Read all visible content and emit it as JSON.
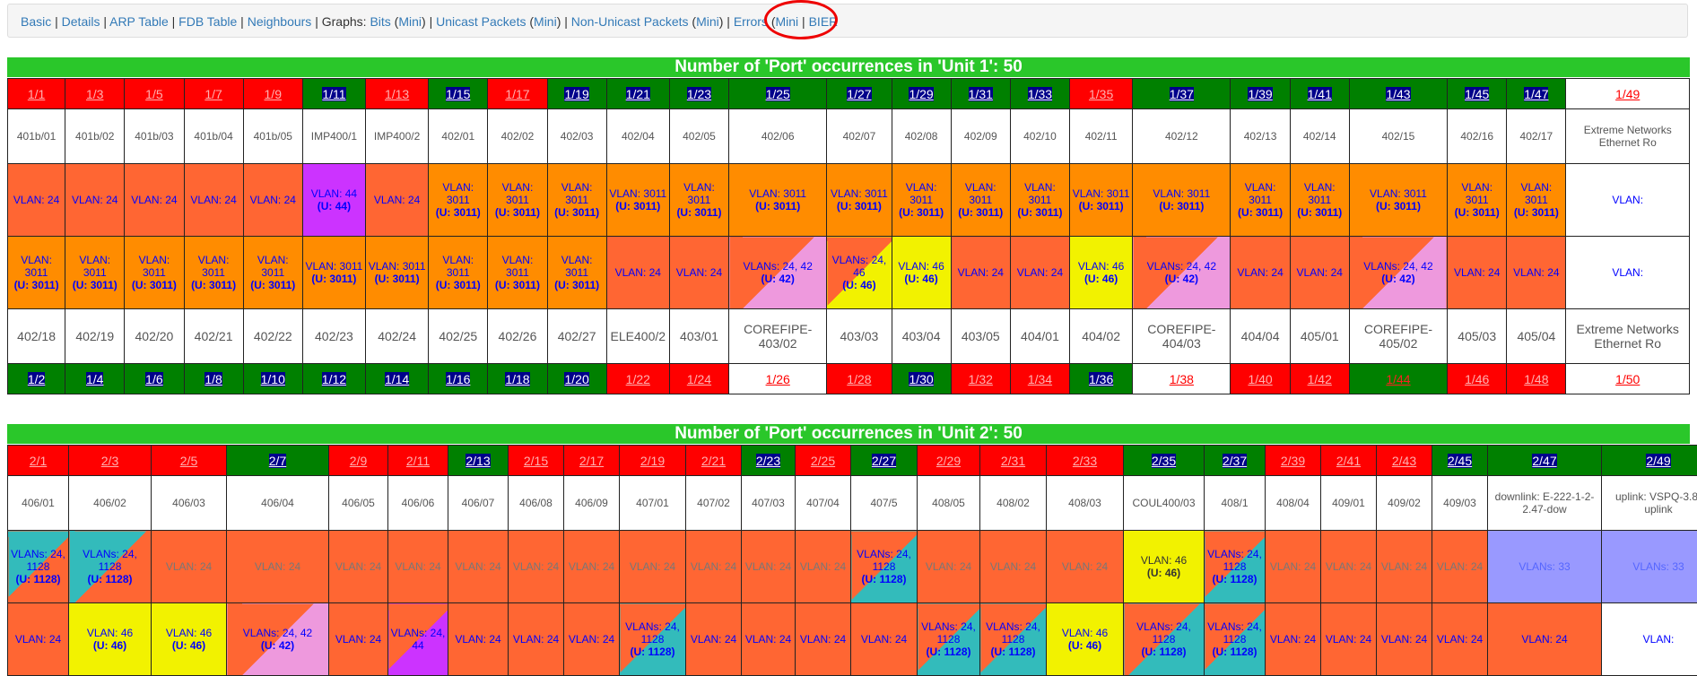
{
  "nav": {
    "basic": "Basic",
    "details": "Details",
    "arp": "ARP Table",
    "fdb": "FDB Table",
    "neighbours": "Neighbours",
    "graphs": "Graphs:",
    "bits": "Bits",
    "unicast": "Unicast Packets",
    "nonunicast": "Non-Unicast Packets",
    "errors": "Errors",
    "mini": "Mini",
    "bier": "BIER"
  },
  "unit1": {
    "title": "Number of 'Port' occurrences in 'Unit 1': 50",
    "top_ports": [
      "1/1",
      "1/3",
      "1/5",
      "1/7",
      "1/9",
      "1/11",
      "1/13",
      "1/15",
      "1/17",
      "1/19",
      "1/21",
      "1/23",
      "1/25",
      "1/27",
      "1/29",
      "1/31",
      "1/33",
      "1/35",
      "1/37",
      "1/39",
      "1/41",
      "1/43",
      "1/45",
      "1/47",
      "1/49"
    ],
    "top_desc": [
      "401b/01",
      "401b/02",
      "401b/03",
      "401b/04",
      "401b/05",
      "IMP400/1",
      "IMP400/2",
      "402/01",
      "402/02",
      "402/03",
      "402/04",
      "402/05",
      "402/06",
      "402/07",
      "402/08",
      "402/09",
      "402/10",
      "402/11",
      "402/12",
      "402/13",
      "402/14",
      "402/15",
      "402/16",
      "402/17",
      "Extreme Networks Ethernet Ro"
    ],
    "top_vlan_a": [
      "VLAN: 24",
      "VLAN: 24",
      "VLAN: 24",
      "VLAN: 24",
      "VLAN: 24",
      "VLAN: 44",
      "VLAN: 24",
      "VLAN: 3011",
      "VLAN: 3011",
      "VLAN: 3011",
      "VLAN: 3011",
      "VLAN: 3011",
      "VLAN: 3011",
      "VLAN: 3011",
      "VLAN: 3011",
      "VLAN: 3011",
      "VLAN: 3011",
      "VLAN: 3011",
      "VLAN: 3011",
      "VLAN: 3011",
      "VLAN: 3011",
      "VLAN: 3011",
      "VLAN: 3011",
      "VLAN: 3011",
      "VLAN:"
    ],
    "top_vlan_b": [
      "",
      "",
      "",
      "",
      "",
      "(U: 44)",
      "",
      "(U: 3011)",
      "(U: 3011)",
      "(U: 3011)",
      "(U: 3011)",
      "(U: 3011)",
      "(U: 3011)",
      "(U: 3011)",
      "(U: 3011)",
      "(U: 3011)",
      "(U: 3011)",
      "(U: 3011)",
      "(U: 3011)",
      "(U: 3011)",
      "(U: 3011)",
      "(U: 3011)",
      "(U: 3011)",
      "(U: 3011)",
      ""
    ],
    "bot_vlan_a": [
      "VLAN: 3011",
      "VLAN: 3011",
      "VLAN: 3011",
      "VLAN: 3011",
      "VLAN: 3011",
      "VLAN: 3011",
      "VLAN: 3011",
      "VLAN: 3011",
      "VLAN: 3011",
      "VLAN: 3011",
      "VLAN: 24",
      "VLAN: 24",
      "VLANs: 24, 42",
      "VLANs: 24, 46",
      "VLAN: 46",
      "VLAN: 24",
      "VLAN: 24",
      "VLAN: 46",
      "VLANs: 24, 42",
      "VLAN: 24",
      "VLAN: 24",
      "VLANs: 24, 42",
      "VLAN: 24",
      "VLAN: 24",
      "VLAN:"
    ],
    "bot_vlan_b": [
      "(U: 3011)",
      "(U: 3011)",
      "(U: 3011)",
      "(U: 3011)",
      "(U: 3011)",
      "(U: 3011)",
      "(U: 3011)",
      "(U: 3011)",
      "(U: 3011)",
      "(U: 3011)",
      "",
      "",
      "(U: 42)",
      "(U: 46)",
      "(U: 46)",
      "",
      "",
      "(U: 46)",
      "(U: 42)",
      "",
      "",
      "(U: 42)",
      "",
      "",
      ""
    ],
    "bot_desc": [
      "402/18",
      "402/19",
      "402/20",
      "402/21",
      "402/22",
      "402/23",
      "402/24",
      "402/25",
      "402/26",
      "402/27",
      "ELE400/2",
      "403/01",
      "COREFIPE-403/02",
      "403/03",
      "403/04",
      "403/05",
      "404/01",
      "404/02",
      "COREFIPE-404/03",
      "404/04",
      "405/01",
      "COREFIPE-405/02",
      "405/03",
      "405/04",
      "Extreme Networks Ethernet Ro"
    ],
    "bot_ports": [
      "1/2",
      "1/4",
      "1/6",
      "1/8",
      "1/10",
      "1/12",
      "1/14",
      "1/16",
      "1/18",
      "1/20",
      "1/22",
      "1/24",
      "1/26",
      "1/28",
      "1/30",
      "1/32",
      "1/34",
      "1/36",
      "1/38",
      "1/40",
      "1/42",
      "1/44",
      "1/46",
      "1/48",
      "1/50"
    ]
  },
  "unit2": {
    "title": "Number of 'Port' occurrences in 'Unit 2': 50",
    "top_ports": [
      "2/1",
      "2/3",
      "2/5",
      "2/7",
      "2/9",
      "2/11",
      "2/13",
      "2/15",
      "2/17",
      "2/19",
      "2/21",
      "2/23",
      "2/25",
      "2/27",
      "2/29",
      "2/31",
      "2/33",
      "2/35",
      "2/37",
      "2/39",
      "2/41",
      "2/43",
      "2/45",
      "2/47",
      "2/49"
    ],
    "top_desc": [
      "406/01",
      "406/02",
      "406/03",
      "406/04",
      "406/05",
      "406/06",
      "406/07",
      "406/08",
      "406/09",
      "407/01",
      "407/02",
      "407/03",
      "407/04",
      "407/5",
      "408/05",
      "408/02",
      "408/03",
      "COUL400/03",
      "408/1",
      "408/04",
      "409/01",
      "409/02",
      "409/03",
      "downlink: E-222-1-2-2.47-dow",
      "uplink: VSPQ-3.8-uplink"
    ],
    "top_vlan_a": [
      "VLANs: 24, 1128",
      "VLANs: 24, 1128",
      "VLAN: 24",
      "VLAN: 24",
      "VLAN: 24",
      "VLAN: 24",
      "VLAN: 24",
      "VLAN: 24",
      "VLAN: 24",
      "VLAN: 24",
      "VLAN: 24",
      "VLAN: 24",
      "VLAN: 24",
      "VLANs: 24, 1128",
      "VLAN: 24",
      "VLAN: 24",
      "VLAN: 24",
      "VLAN: 46",
      "VLANs: 24, 1128",
      "VLAN: 24",
      "VLAN: 24",
      "VLAN: 24",
      "VLAN: 24",
      "VLANs: 33",
      "VLANs: 33"
    ],
    "top_vlan_b": [
      "(U: 1128)",
      "(U: 1128)",
      "",
      "",
      "",
      "",
      "",
      "",
      "",
      "",
      "",
      "",
      "",
      "(U: 1128)",
      "",
      "",
      "",
      "(U: 46)",
      "(U: 1128)",
      "",
      "",
      "",
      "",
      "",
      ""
    ],
    "bot_vlan_a": [
      "VLAN: 24",
      "VLAN: 46",
      "VLAN: 46",
      "VLANs: 24, 42",
      "VLAN: 24",
      "VLANs: 24, 44",
      "VLAN: 24",
      "VLAN: 24",
      "VLAN: 24",
      "VLANs: 24, 1128",
      "VLAN: 24",
      "VLAN: 24",
      "VLAN: 24",
      "VLAN: 24",
      "VLANs: 24, 1128",
      "VLANs: 24, 1128",
      "VLAN: 46",
      "VLANs: 24, 1128",
      "VLANs: 24, 1128",
      "VLAN: 24",
      "VLAN: 24",
      "VLAN: 24",
      "VLAN: 24",
      "VLAN: 24",
      "VLAN:"
    ],
    "bot_vlan_b": [
      "",
      "(U: 46)",
      "(U: 46)",
      "(U: 42)",
      "",
      "",
      "",
      "",
      "",
      "(U: 1128)",
      "",
      "",
      "",
      "",
      "(U: 1128)",
      "(U: 1128)",
      "(U: 46)",
      "(U: 1128)",
      "(U: 1128)",
      "",
      "",
      "",
      "",
      "",
      ""
    ]
  }
}
